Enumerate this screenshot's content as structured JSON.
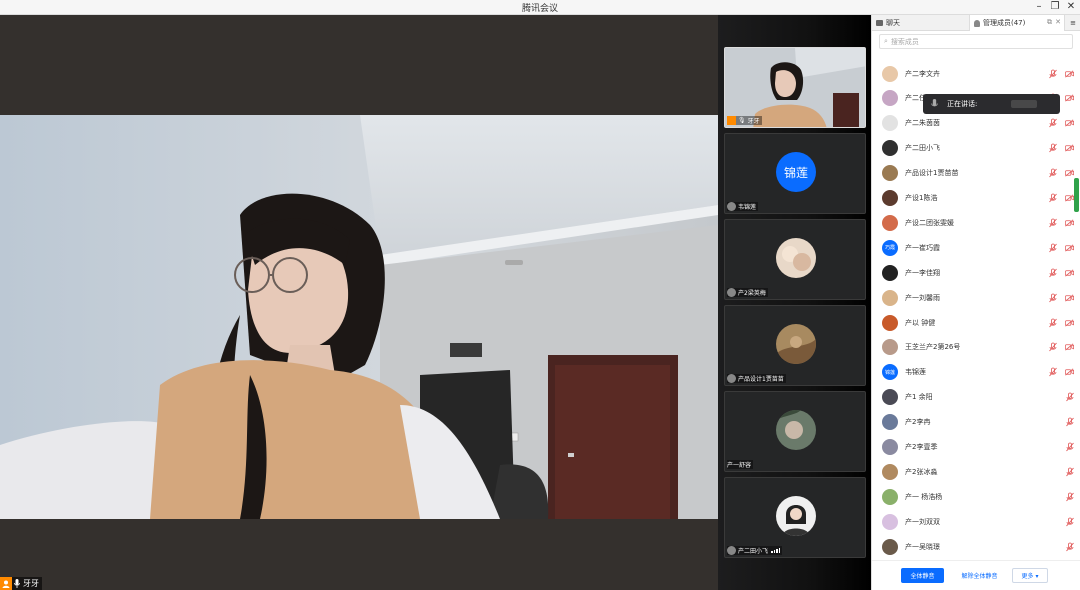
{
  "window": {
    "title": "腾讯会议"
  },
  "main_video": {
    "speaker_name": "牙牙"
  },
  "side_tiles": [
    {
      "name": "牙牙",
      "type": "video"
    },
    {
      "name": "韦锦莲",
      "type": "text-avatar",
      "avatar_text": "锦莲"
    },
    {
      "name": "产2梁英梅",
      "type": "photo-avatar"
    },
    {
      "name": "产品设计1贾苗苗",
      "type": "photo-avatar"
    },
    {
      "name": "产一舒容",
      "type": "photo-avatar"
    },
    {
      "name": "产二田小飞",
      "type": "photo-avatar"
    }
  ],
  "panel": {
    "tab_chat": "聊天",
    "tab_members": "管理成员(47)",
    "search_placeholder": "搜索成员",
    "tooltip": {
      "label": "正在讲话:"
    },
    "members": [
      {
        "name": "产二李文卉",
        "avatar_color": "#e8c8a8",
        "camera": true
      },
      {
        "name": "产二任",
        "avatar_color": "#c6a6c4",
        "camera": true
      },
      {
        "name": "产二朱茵茵",
        "avatar_color": "#e2e2e2",
        "camera": true
      },
      {
        "name": "产二田小飞",
        "avatar_color": "#303030",
        "camera": true
      },
      {
        "name": "产品设计1贾苗苗",
        "avatar_color": "#9a7a52",
        "camera": true
      },
      {
        "name": "产设1陈浩",
        "avatar_color": "#5c3b2e",
        "camera": true
      },
      {
        "name": "产设二团张雯媛",
        "avatar_color": "#d36b4a",
        "camera": true
      },
      {
        "name": "产一崔巧霞",
        "avatar_color": "#0a6cff",
        "avatar_text": "巧霞",
        "camera": true
      },
      {
        "name": "产一李佳翔",
        "avatar_color": "#222222",
        "camera": true
      },
      {
        "name": "产一刘馨雨",
        "avatar_color": "#d9b48a",
        "camera": true
      },
      {
        "name": "产以 钟健",
        "avatar_color": "#c85a2a",
        "camera": true
      },
      {
        "name": "王芝兰产2第26号",
        "avatar_color": "#b89a8a",
        "camera": true
      },
      {
        "name": "韦锦莲",
        "avatar_color": "#0a6cff",
        "avatar_text": "锦莲",
        "camera": true
      },
      {
        "name": "产1 余阳",
        "avatar_color": "#4a4a55",
        "camera": false
      },
      {
        "name": "产2李冉",
        "avatar_color": "#6a7a9a",
        "camera": false
      },
      {
        "name": "产2李壹季",
        "avatar_color": "#8a8aa0",
        "camera": false
      },
      {
        "name": "产2张冰淼",
        "avatar_color": "#b08a60",
        "camera": false
      },
      {
        "name": "产一 杨浩杨",
        "avatar_color": "#8ab06a",
        "camera": false
      },
      {
        "name": "产一刘双双",
        "avatar_color": "#d8c0e0",
        "camera": false
      },
      {
        "name": "产一吴晓璟",
        "avatar_color": "#6a5a4a",
        "camera": false
      }
    ],
    "footer": {
      "mute_all": "全体静音",
      "unmute_all": "解除全体静音",
      "more": "更多 ▾"
    }
  },
  "colors": {
    "accent": "#0a6cff",
    "speaking_green": "#2fa24a",
    "muted_red": "#e05555"
  }
}
